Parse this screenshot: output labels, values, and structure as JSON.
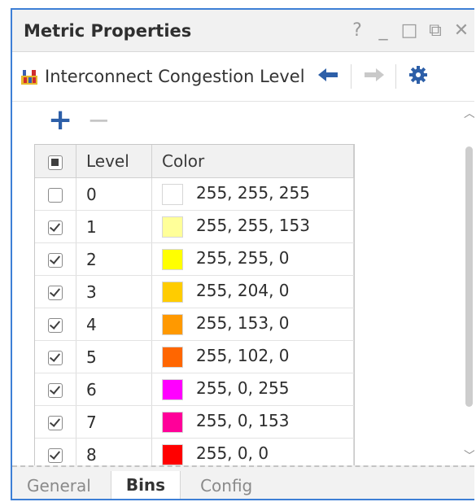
{
  "window": {
    "title": "Metric Properties",
    "controls": [
      "?",
      "_",
      "□",
      "⧉",
      "✕"
    ]
  },
  "toolbar": {
    "metric_name": "Interconnect Congestion Level",
    "metric_icon": "heatmap-icon",
    "back_icon": "arrow-left-icon",
    "forward_icon": "arrow-right-icon",
    "settings_icon": "gear-icon"
  },
  "bins": {
    "add_label": "+",
    "remove_label": "−",
    "columns": [
      "Level",
      "Color"
    ],
    "rows": [
      {
        "checked": false,
        "level": "0",
        "color_text": "255, 255, 255",
        "color": "#ffffff"
      },
      {
        "checked": true,
        "level": "1",
        "color_text": "255, 255, 153",
        "color": "#ffff99"
      },
      {
        "checked": true,
        "level": "2",
        "color_text": "255, 255, 0",
        "color": "#ffff00"
      },
      {
        "checked": true,
        "level": "3",
        "color_text": "255, 204, 0",
        "color": "#ffcc00"
      },
      {
        "checked": true,
        "level": "4",
        "color_text": "255, 153, 0",
        "color": "#ff9900"
      },
      {
        "checked": true,
        "level": "5",
        "color_text": "255, 102, 0",
        "color": "#ff6600"
      },
      {
        "checked": true,
        "level": "6",
        "color_text": "255, 0, 255",
        "color": "#ff00ff"
      },
      {
        "checked": true,
        "level": "7",
        "color_text": "255, 0, 153",
        "color": "#ff0099"
      },
      {
        "checked": true,
        "level": "8",
        "color_text": "255, 0, 0",
        "color": "#ff0000"
      }
    ]
  },
  "tabs": [
    {
      "label": "General",
      "active": false
    },
    {
      "label": "Bins",
      "active": true
    },
    {
      "label": "Config",
      "active": false
    }
  ],
  "colors": {
    "accent": "#2d5fa8",
    "window_border": "#3d7fd6"
  }
}
